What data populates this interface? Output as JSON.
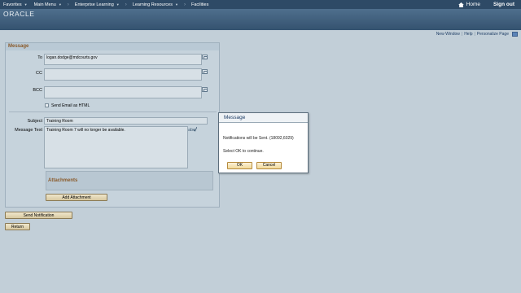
{
  "topnav": {
    "items": [
      {
        "label": "Favorites",
        "has_menu": true
      },
      {
        "label": "Main Menu",
        "has_menu": true
      },
      {
        "label": "Enterprise Learning",
        "has_menu": true
      },
      {
        "label": "Learning Resources",
        "has_menu": true
      },
      {
        "label": "Facilities",
        "has_menu": false
      }
    ],
    "separator": "›",
    "home_label": "Home",
    "signout_label": "Sign out"
  },
  "header": {
    "logo_text": "ORACLE"
  },
  "pagebar": {
    "new_window": "New Window",
    "help": "Help",
    "personalize": "Personalize Page",
    "separator": "|"
  },
  "message_form": {
    "group_title": "Message",
    "to_label": "To",
    "to_value": "logan.dodge@mdcourts.gov",
    "cc_label": "CC",
    "cc_value": "",
    "bcc_label": "BCC",
    "bcc_value": "",
    "html_checkbox_label": "Send Email as HTML",
    "html_checked": false,
    "subject_label": "Subject",
    "subject_value": "Training Room",
    "message_label": "Message Text",
    "message_value": "Training Room 7 will no longer be available.",
    "attachments_title": "Attachments",
    "add_attachment_label": "Add Attachment"
  },
  "buttons": {
    "send_notification": "Send Notification",
    "return": "Return"
  },
  "modal": {
    "title": "Message",
    "line1": "Notifications will be Sent. (18092,6029)",
    "line2": "Select OK to continue.",
    "ok_label": "OK",
    "cancel_label": "Cancel"
  },
  "colors": {
    "nav_bg": "#2e4a66",
    "header_bg": "#4f6f8d",
    "page_bg": "#c2cfd8",
    "group_title": "#8a5a2a"
  }
}
